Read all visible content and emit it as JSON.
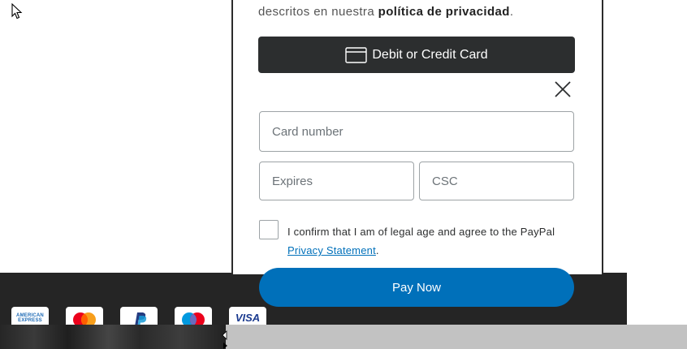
{
  "privacy": {
    "text": "descritos en nuestra ",
    "link": "política de privacidad",
    "suffix": "."
  },
  "payment": {
    "card_button_label": "Debit or Credit Card",
    "card_number_placeholder": "Card number",
    "expires_placeholder": "Expires",
    "csc_placeholder": "CSC",
    "consent_text": "I confirm that I am of legal age and agree to the PayPal ",
    "consent_link": "Privacy Statement",
    "consent_suffix": ".",
    "pay_button_label": "Pay Now"
  },
  "accepted_cards": [
    {
      "name": "american-express",
      "label": "AMERICAN EXPRESS"
    },
    {
      "name": "mastercard",
      "label": ""
    },
    {
      "name": "paypal",
      "label": ""
    },
    {
      "name": "maestro",
      "label": ""
    },
    {
      "name": "visa",
      "label": "VISA"
    }
  ],
  "icons": {
    "card": "credit-card-icon",
    "close": "close-icon",
    "cursor": "mouse-cursor-icon"
  },
  "colors": {
    "pay_blue": "#0070ba",
    "dark_button": "#2c2e2f",
    "footer": "#252525"
  }
}
